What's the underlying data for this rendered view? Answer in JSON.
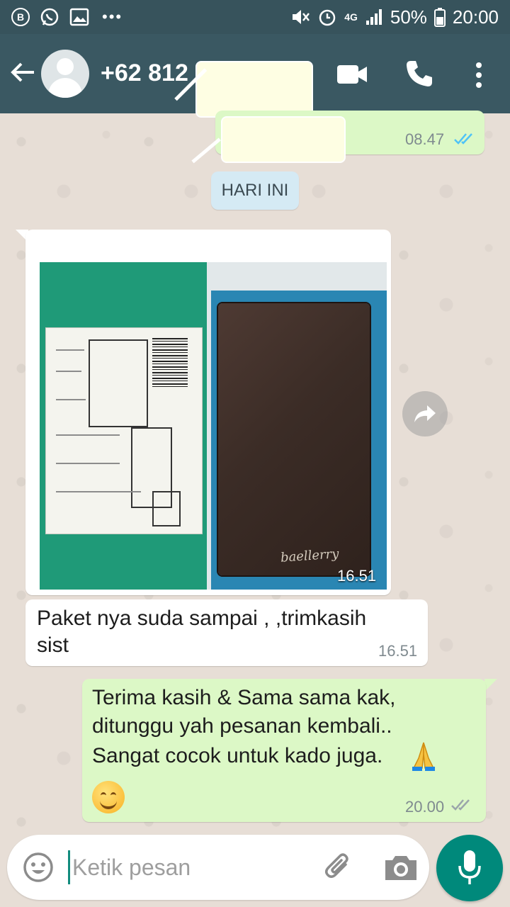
{
  "status_bar": {
    "left_badge": "B",
    "dots": "•••",
    "network": "4G",
    "battery": "50%",
    "time": "20:00"
  },
  "header": {
    "contact_name": "+62 812"
  },
  "messages": [
    {
      "direction": "out",
      "time": "08.47",
      "status": "read"
    },
    {
      "type": "date",
      "text": "HARI INI"
    },
    {
      "direction": "in",
      "type": "image",
      "time": "16.51",
      "image_text": "baellerry"
    },
    {
      "direction": "in",
      "text_lines": [
        "Paket nya suda sampai , ,trimkasih",
        "sist"
      ],
      "time": "16.51"
    },
    {
      "direction": "out",
      "text_lines": [
        "Terima kasih & Sama sama kak,",
        "ditunggu yah pesanan kembali..",
        "Sangat cocok untuk kado juga."
      ],
      "emoji": [
        "🙏",
        "😊"
      ],
      "time": "20.00",
      "status": "delivered"
    }
  ],
  "input": {
    "placeholder": "Ketik pesan"
  },
  "colors": {
    "header": "#3a5862",
    "status_bar": "#37535c",
    "outgoing_bubble": "#dcf8c6",
    "incoming_bubble": "#ffffff",
    "read_ticks": "#4fc3f7",
    "mic_button": "#00897b"
  },
  "icons": [
    "back-arrow-icon",
    "video-call-icon",
    "phone-icon",
    "menu-icon",
    "forward-icon",
    "emoji-icon",
    "attach-icon",
    "camera-icon",
    "mic-icon"
  ]
}
